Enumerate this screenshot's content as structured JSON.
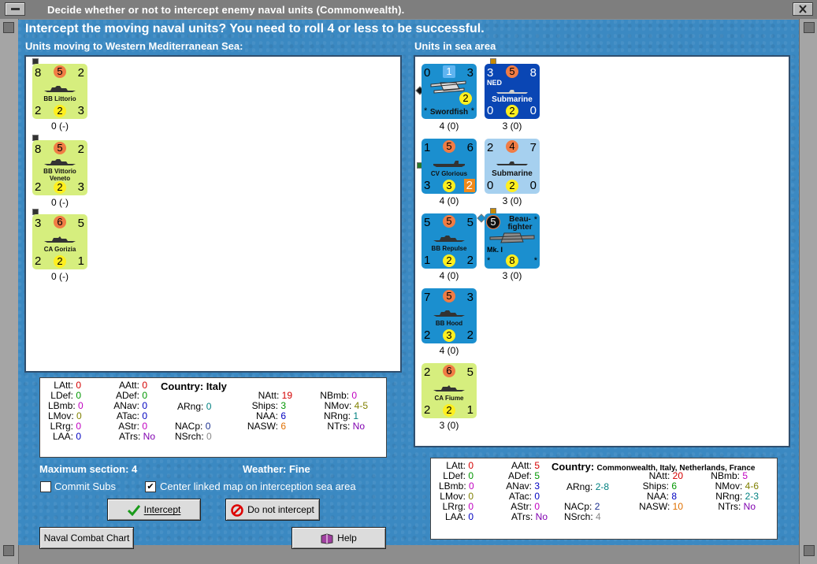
{
  "window": {
    "title": "Decide whether or not to intercept enemy naval units (Commonwealth)."
  },
  "headline": "Intercept the moving naval units?  You need to roll 4 or less to be successful.",
  "left_label": "Units moving to Western Mediterranean Sea:",
  "right_label": "Units in sea area",
  "moving_units": [
    {
      "name": "BB Littorio",
      "tl": "8",
      "tc": "5",
      "tr": "2",
      "bl": "2",
      "bc": "2",
      "br": "3",
      "strength": "0 (-)"
    },
    {
      "name": "BB Vittorio Veneto",
      "tl": "8",
      "tc": "5",
      "tr": "2",
      "bl": "2",
      "bc": "2",
      "br": "3",
      "strength": "0 (-)"
    },
    {
      "name": "CA Gorizia",
      "tl": "3",
      "tc": "6",
      "tr": "5",
      "bl": "2",
      "bc": "2",
      "br": "1",
      "strength": "0 (-)"
    }
  ],
  "sea_units": [
    {
      "name": "Swordfish",
      "tl": "0",
      "tc": "1",
      "tr": "3",
      "bc": "2",
      "strength": "4 (0)"
    },
    {
      "name": "Submarine",
      "tag": "NED",
      "tl": "3",
      "tc": "5",
      "tr": "8",
      "bl": "0",
      "bc": "2",
      "br": "0",
      "strength": "3 (0)"
    },
    {
      "name": "CV Glorious",
      "tl": "1",
      "tc": "5",
      "tr": "6",
      "bl": "3",
      "bc": "3",
      "br": "2",
      "strength": "4 (0)"
    },
    {
      "name": "Submarine",
      "tl": "2",
      "tc": "4",
      "tr": "7",
      "bl": "0",
      "bc": "2",
      "br": "0",
      "strength": "3 (0)"
    },
    {
      "name": "BB Repulse",
      "tl": "5",
      "tc": "5",
      "tr": "5",
      "bl": "1",
      "bc": "2",
      "br": "2",
      "strength": "4 (0)"
    },
    {
      "name": "Beau-fighter Mk. I",
      "name1": "Beau-",
      "name2": "fighter",
      "name3": "Mk. I",
      "tc": "5",
      "bc": "8",
      "strength": "3 (0)"
    },
    {
      "name": "BB Hood",
      "tl": "7",
      "tc": "5",
      "tr": "3",
      "bl": "2",
      "bc": "3",
      "br": "2",
      "strength": "4 (0)"
    },
    {
      "name": "CA Fiume",
      "tl": "2",
      "tc": "6",
      "tr": "5",
      "bl": "2",
      "bc": "2",
      "br": "1",
      "strength": "3 (0)"
    }
  ],
  "left_stats": {
    "country_label": "Country:",
    "country": "Italy",
    "rows": [
      [
        "LAtt:",
        "0",
        "AAtt:",
        "0"
      ],
      [
        "LDef:",
        "0",
        "ADef:",
        "0"
      ],
      [
        "LBmb:",
        "0",
        "ANav:",
        "0"
      ],
      [
        "LMov:",
        "0",
        "ATac:",
        "0"
      ],
      [
        "LRrg:",
        "0",
        "AStr:",
        "0"
      ],
      [
        "LAA:",
        "0",
        "ATrs:",
        "No"
      ]
    ],
    "arng": [
      "ARng:",
      "0"
    ],
    "nacp": [
      "NACp:",
      "0"
    ],
    "nsrch": [
      "NSrch:",
      "0"
    ],
    "naval": [
      [
        "NAtt:",
        "19",
        "NBmb:",
        "0"
      ],
      [
        "Ships:",
        "3",
        "NMov:",
        "4-5"
      ],
      [
        "NAA:",
        "6",
        "NRng:",
        "1"
      ],
      [
        "NASW:",
        "6",
        "NTrs:",
        "No"
      ]
    ]
  },
  "right_stats": {
    "country_label": "Country:",
    "country": "Commonwealth, Italy, Netherlands, France",
    "rows": [
      [
        "LAtt:",
        "0",
        "AAtt:",
        "5"
      ],
      [
        "LDef:",
        "0",
        "ADef:",
        "5"
      ],
      [
        "LBmb:",
        "0",
        "ANav:",
        "3"
      ],
      [
        "LMov:",
        "0",
        "ATac:",
        "0"
      ],
      [
        "LRrg:",
        "0",
        "AStr:",
        "0"
      ],
      [
        "LAA:",
        "0",
        "ATrs:",
        "No"
      ]
    ],
    "arng": [
      "ARng:",
      "2-8"
    ],
    "nacp": [
      "NACp:",
      "2"
    ],
    "nsrch": [
      "NSrch:",
      "4"
    ],
    "naval": [
      [
        "NAtt:",
        "20",
        "NBmb:",
        "5"
      ],
      [
        "Ships:",
        "6",
        "NMov:",
        "4-6"
      ],
      [
        "NAA:",
        "8",
        "NRng:",
        "2-3"
      ],
      [
        "NASW:",
        "10",
        "NTrs:",
        "No"
      ]
    ]
  },
  "info": {
    "max_section": "Maximum section: 4",
    "weather": "Weather:  Fine",
    "commit_subs": "Commit Subs",
    "center_map": "Center linked map on interception sea area"
  },
  "buttons": {
    "intercept": "Intercept",
    "do_not_intercept": "Do not intercept",
    "naval_chart": "Naval Combat Chart",
    "help": "Help"
  }
}
